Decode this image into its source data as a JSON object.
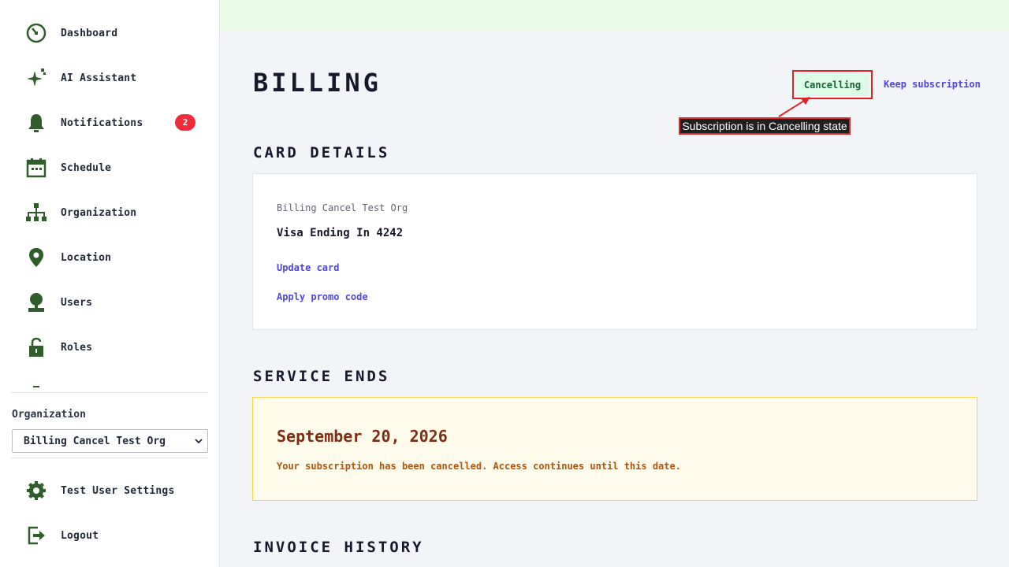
{
  "sidebar": {
    "items": [
      {
        "label": "Dashboard",
        "icon": "dashboard-icon"
      },
      {
        "label": "AI Assistant",
        "icon": "sparkle-icon"
      },
      {
        "label": "Notifications",
        "icon": "bell-icon",
        "badge": "2"
      },
      {
        "label": "Schedule",
        "icon": "calendar-icon"
      },
      {
        "label": "Organization",
        "icon": "org-chart-icon"
      },
      {
        "label": "Location",
        "icon": "location-pin-icon"
      },
      {
        "label": "Users",
        "icon": "user-icon"
      },
      {
        "label": "Roles",
        "icon": "lock-icon"
      }
    ],
    "organization_label": "Organization",
    "organization_selected": "Billing Cancel Test Org",
    "settings_label": "Test User Settings",
    "logout_label": "Logout"
  },
  "page": {
    "title": "BILLING",
    "status": "Cancelling",
    "keep_subscription": "Keep subscription",
    "annotation": "Subscription is in Cancelling state"
  },
  "card_details": {
    "heading": "CARD DETAILS",
    "org_name": "Billing Cancel Test Org",
    "card": "Visa Ending In 4242",
    "update_card": "Update card",
    "apply_promo": "Apply promo code"
  },
  "service_ends": {
    "heading": "SERVICE ENDS",
    "date": "September 20, 2026",
    "note": "Your subscription has been cancelled. Access continues until this date."
  },
  "invoice_history": {
    "heading": "INVOICE HISTORY"
  },
  "colors": {
    "icon": "#2f5e2a",
    "accent_link": "#4f46e5",
    "badge": "#ef2b3c",
    "status_bg": "#dcfce7",
    "annotation_border": "#e02424"
  }
}
